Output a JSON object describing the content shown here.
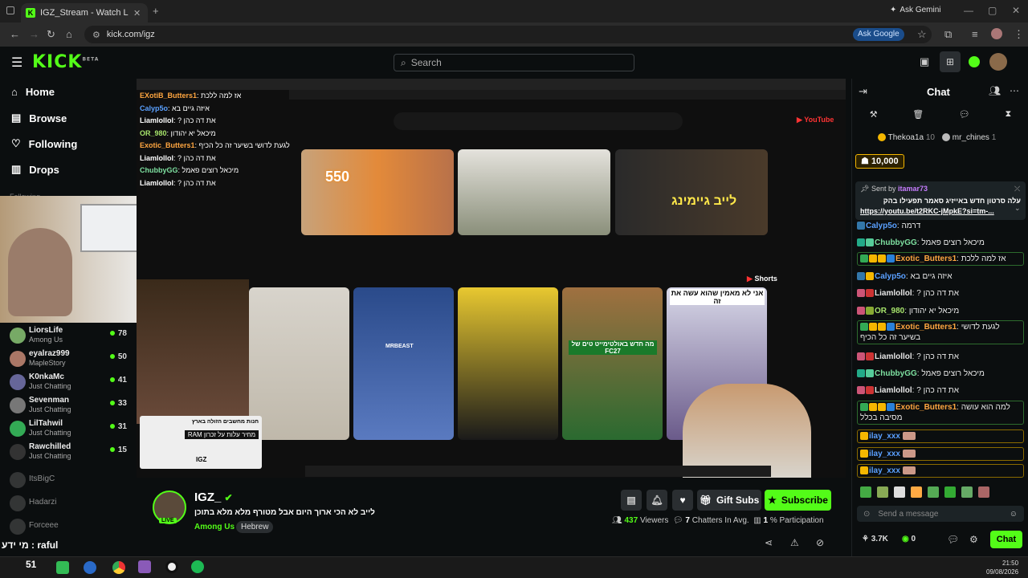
{
  "browser": {
    "tab_title": "IGZ_Stream - Watch Live o",
    "new_tab": "+",
    "url": "kick.com/igz",
    "ask_gemini": "Ask Gemini",
    "ask_google": "Ask Google"
  },
  "header": {
    "logo": "KICK",
    "logo_tag": "BETA",
    "search_placeholder": "Search"
  },
  "sidebar": {
    "nav": [
      {
        "label": "Home",
        "icon": "home-icon"
      },
      {
        "label": "Browse",
        "icon": "browse-icon"
      },
      {
        "label": "Following",
        "icon": "heart-icon"
      },
      {
        "label": "Drops",
        "icon": "drops-icon"
      }
    ],
    "section": "Following",
    "channels": [
      {
        "name": "LiorsLife",
        "game": "Among Us",
        "viewers": "78",
        "color": "#7a6"
      },
      {
        "name": "eyalraz999",
        "game": "MapleStory",
        "viewers": "50",
        "color": "#a76"
      },
      {
        "name": "K0nkaMc",
        "game": "Just Chatting",
        "viewers": "41",
        "color": "#669"
      },
      {
        "name": "Sevenman",
        "game": "Just Chatting",
        "viewers": "33",
        "color": "#777"
      },
      {
        "name": "LilTahwil",
        "game": "Just Chatting",
        "viewers": "31",
        "color": "#3a5"
      },
      {
        "name": "Rawchilled",
        "game": "Just Chatting",
        "viewers": "15",
        "color": "#333"
      }
    ],
    "offline": [
      "ItsBigC",
      "Hadarzi",
      "Forceee"
    ]
  },
  "stream": {
    "overlay_chat": [
      {
        "user": "EXotiB_Butters1",
        "msg": "אז למה ללכת"
      },
      {
        "user": "Calyp5o",
        "msg": "איזה גיים בא"
      },
      {
        "user": "Liamlollol",
        "msg": "את דה כהן ?"
      },
      {
        "user": "OR_980",
        "msg": "מיכאל יא יהודון"
      },
      {
        "user": "Exotic_Butters1",
        "msg": "לגעת לדושי בשיער זה כל הכיף"
      },
      {
        "user": "Liamlollol",
        "msg": "את דה כהן ?"
      },
      {
        "user": "ChubbyGG",
        "msg": "מיכאל רוצים פאמל"
      },
      {
        "user": "Liamlollol",
        "msg": "את דה כהן ?"
      }
    ],
    "yt_thumb_texts": [
      "550",
      "לייב גיימינג",
      "מה חדש באולטימייט טים של FC27",
      "אני לא מאמין שהוא עשה את זה",
      "Shorts",
      "MRBEAST",
      "חנות מחשבים הזולה בארץ",
      "מחיר עלות על זכרון RAM",
      "IGZ"
    ],
    "bottom_ticker": "מי ידע : raful",
    "ticker_count": "51"
  },
  "channel": {
    "name": "IGZ_",
    "live": "LIVE",
    "title": "לייב לא הכי ארוך היום אבל מטורף מלא מלא בתוכן",
    "category": "Among Us",
    "language": "Hebrew",
    "gift_subs": "Gift Subs",
    "subscribe": "Subscribe",
    "viewers": "437",
    "viewers_label": "Viewers",
    "chatters": "7",
    "chatters_label": "Chatters In Avg.",
    "participation": "1",
    "participation_label": "% Participation"
  },
  "chat": {
    "title": "Chat",
    "leaders": [
      {
        "name": "Thekoa1a",
        "count": "10"
      },
      {
        "name": "mr_chines",
        "count": "1"
      }
    ],
    "kicks_total": "10,000",
    "pinned_sent_by": "Sent by",
    "pinned_user": "itamar73",
    "pinned_msg": "עלה סרטון חדש באייזיג סאמר תפעילו בהק",
    "pinned_link": "https://youtu.be/t2RKC-jMpkE?si=tm-...",
    "messages": [
      {
        "user": "Calyp5o",
        "text": "דרמה",
        "color": "#5aa0ff"
      },
      {
        "user": "ChubbyGG",
        "text": "מיכאל רוצים פאמל",
        "color": "#7ee0a0"
      },
      {
        "user": "Exotic_Butters1",
        "text": "אז למה ללכת",
        "color": "#ffa640"
      },
      {
        "user": "Calyp5o",
        "text": "איזה גיים בא",
        "color": "#5aa0ff"
      },
      {
        "user": "Liamlollol",
        "text": "את דה כהן ?",
        "color": "#ffffff"
      },
      {
        "user": "OR_980",
        "text": "מיכאל יא יהודון",
        "color": "#a6e36b"
      },
      {
        "user": "Exotic_Butters1",
        "text": "לגעת לדושי בשיער זה כל הכיף",
        "color": "#ffa640"
      },
      {
        "user": "Liamlollol",
        "text": "את דה כהן ?",
        "color": "#ffffff"
      },
      {
        "user": "ChubbyGG",
        "text": "מיכאל רוצים פאמל",
        "color": "#7ee0a0"
      },
      {
        "user": "Liamlollol",
        "text": "את דה כהן ?",
        "color": "#ffffff"
      },
      {
        "user": "Exotic_Butters1",
        "text": "למה הוא עושה מסיבה בכלל",
        "color": "#ffa640"
      },
      {
        "user": "ilay_xxx",
        "text": "",
        "color": "#5aa0ff"
      },
      {
        "user": "ilay_xxx",
        "text": "",
        "color": "#5aa0ff"
      },
      {
        "user": "ilay_xxx",
        "text": "",
        "color": "#5aa0ff"
      }
    ],
    "input_placeholder": "Send a message",
    "points": "3.7K",
    "kicks": "0",
    "send_label": "Chat"
  },
  "system": {
    "time": "21:50",
    "date": "09/08/2026"
  },
  "colors": {
    "accent": "#53fc18",
    "bg": "#0b0e0f"
  }
}
